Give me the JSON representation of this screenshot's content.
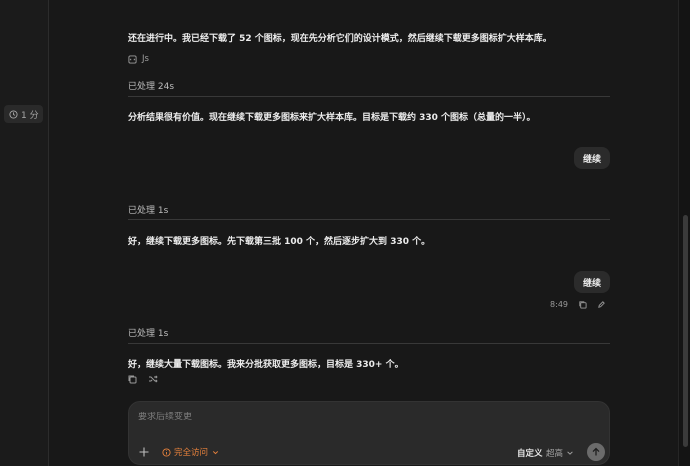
{
  "sidebar": {
    "time_chip": "1 分",
    "clock_icon": "clock-icon"
  },
  "messages": {
    "m1": "还在进行中。我已经下载了 52 个图标，现在先分析它们的设计模式，然后继续下载更多图标扩大样本库。",
    "file_chip": "Js",
    "processed_1": "已处理 24s",
    "m2": "分析结果很有价值。现在继续下载更多图标来扩大样本库。目标是下载约 330 个图标（总量的一半）。",
    "user_1": "继续",
    "processed_2": "已处理 1s",
    "m3": "好，继续下载更多图标。先下载第三批 100 个，然后逐步扩大到 330 个。",
    "user_2": "继续",
    "user_2_time": "8:49",
    "processed_3": "已处理 1s",
    "m4": "好，继续大量下载图标。我来分批获取更多图标，目标是 330+ 个。"
  },
  "composer": {
    "placeholder": "要求后续变更",
    "access_label": "完全访问",
    "custom_label": "自定义",
    "level_label": "超高"
  },
  "colors": {
    "background": "#181818",
    "accent": "#e8823c"
  }
}
